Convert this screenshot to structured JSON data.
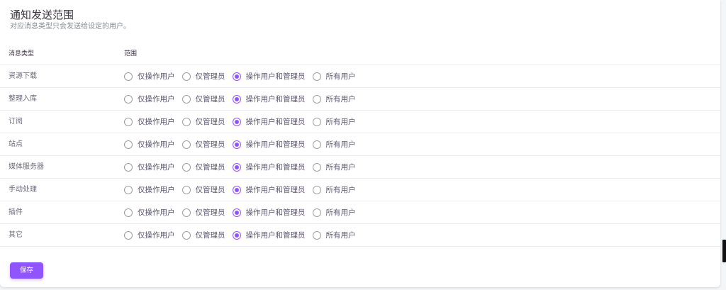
{
  "header": {
    "title": "通知发送范围",
    "subtitle": "对应消息类型只会发送给设定的用户。"
  },
  "table": {
    "columns": [
      "消息类型",
      "范围"
    ],
    "options": [
      "仅操作用户",
      "仅管理员",
      "操作用户和管理员",
      "所有用户"
    ],
    "rows": [
      {
        "type": "资源下载",
        "selected": "操作用户和管理员"
      },
      {
        "type": "整理入库",
        "selected": "操作用户和管理员"
      },
      {
        "type": "订阅",
        "selected": "操作用户和管理员"
      },
      {
        "type": "站点",
        "selected": "操作用户和管理员"
      },
      {
        "type": "媒体服务器",
        "selected": "操作用户和管理员"
      },
      {
        "type": "手动处理",
        "selected": "操作用户和管理员"
      },
      {
        "type": "插件",
        "selected": "操作用户和管理员"
      },
      {
        "type": "其它",
        "selected": "操作用户和管理员"
      }
    ]
  },
  "actions": {
    "save_label": "保存"
  },
  "colors": {
    "accent": "#9155fd",
    "text": "#3a3541",
    "muted": "#8a8d93",
    "border": "#ececee"
  }
}
